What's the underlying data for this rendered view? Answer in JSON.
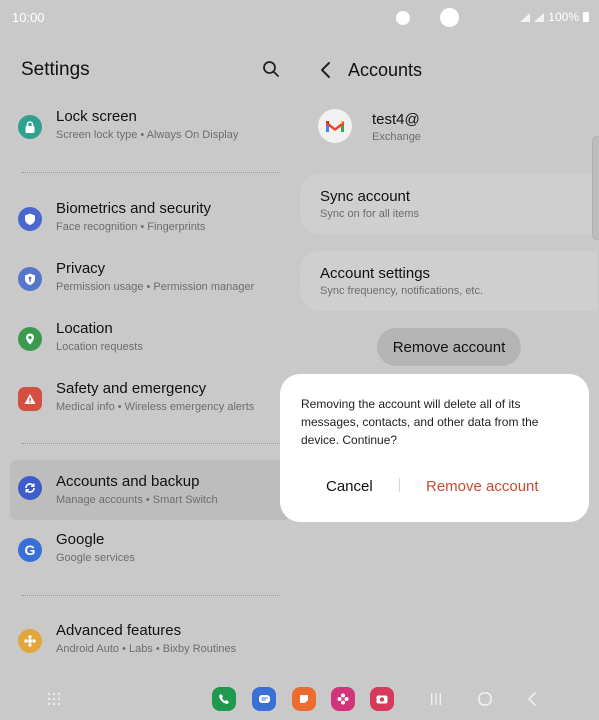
{
  "status": {
    "time": "10:00",
    "battery": "100%"
  },
  "left": {
    "title": "Settings",
    "items": [
      {
        "title": "Lock screen",
        "subtitle": "Screen lock type  •  Always On Display",
        "icon": "lock-icon",
        "color": "#2ea28f"
      },
      {
        "title": "Biometrics and security",
        "subtitle": "Face recognition  •  Fingerprints",
        "icon": "shield-icon",
        "color": "#4a67cf"
      },
      {
        "title": "Privacy",
        "subtitle": "Permission usage  •  Permission manager",
        "icon": "privacy-shield-icon",
        "color": "#5477cc"
      },
      {
        "title": "Location",
        "subtitle": "Location requests",
        "icon": "location-pin-icon",
        "color": "#3c9a4f"
      },
      {
        "title": "Safety and emergency",
        "subtitle": "Medical info  •  Wireless emergency alerts",
        "icon": "emergency-icon",
        "color": "#d24f42"
      },
      {
        "title": "Accounts and backup",
        "subtitle": "Manage accounts  •  Smart Switch",
        "icon": "sync-icon",
        "color": "#3e5dc9"
      },
      {
        "title": "Google",
        "subtitle": "Google services",
        "icon": "google-icon",
        "color": "#3b6fd8"
      },
      {
        "title": "Advanced features",
        "subtitle": "Android Auto  •  Labs  •  Bixby Routines",
        "icon": "puzzle-icon",
        "color": "#e3a63a"
      }
    ]
  },
  "right": {
    "title": "Accounts",
    "account": {
      "name": "test4@",
      "type": "Exchange"
    },
    "cards": [
      {
        "title": "Sync account",
        "subtitle": "Sync on for all items"
      },
      {
        "title": "Account settings",
        "subtitle": "Sync frequency, notifications, etc."
      }
    ],
    "remove_button": "Remove account"
  },
  "dialog": {
    "message": "Removing the account will delete all of its messages, contacts, and other data from the device. Continue?",
    "cancel": "Cancel",
    "confirm": "Remove account"
  },
  "navbar": {
    "apps": [
      {
        "icon": "phone-icon",
        "color": "#1e9a4e"
      },
      {
        "icon": "messages-icon",
        "color": "#3a6fd6"
      },
      {
        "icon": "notes-icon",
        "color": "#ec6b2e"
      },
      {
        "icon": "gallery-icon",
        "color": "#d3337a"
      },
      {
        "icon": "camera-icon",
        "color": "#d63a5a"
      }
    ]
  }
}
